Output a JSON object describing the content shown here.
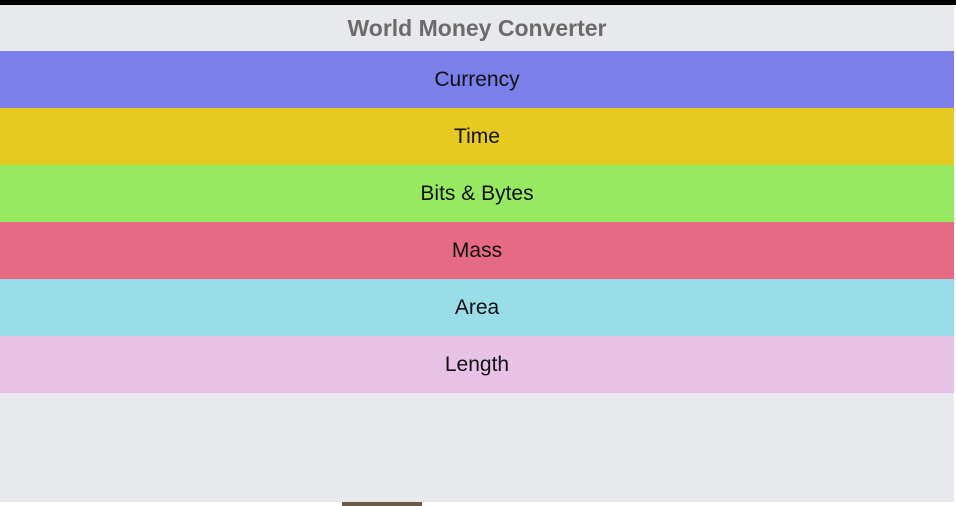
{
  "app": {
    "title": "World Money Converter"
  },
  "menu": {
    "items": [
      {
        "label": "Currency",
        "color": "#7b7fea"
      },
      {
        "label": "Time",
        "color": "#e7ca20"
      },
      {
        "label": "Bits & Bytes",
        "color": "#97ea60"
      },
      {
        "label": "Mass",
        "color": "#e76a84"
      },
      {
        "label": "Area",
        "color": "#98dde8"
      },
      {
        "label": "Length",
        "color": "#e7c2e6"
      }
    ]
  }
}
